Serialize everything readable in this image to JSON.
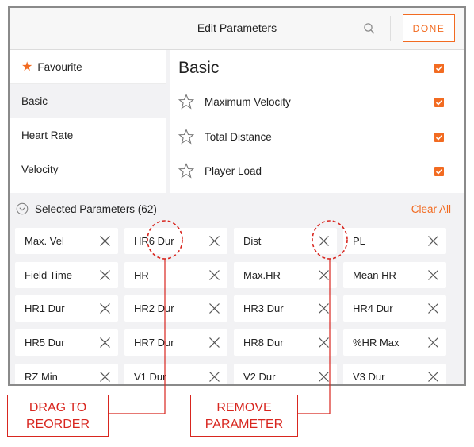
{
  "header": {
    "title": "Edit Parameters",
    "done_label": "DONE"
  },
  "categories": [
    {
      "label": "Favourite",
      "icon": "star-filled-icon"
    },
    {
      "label": "Basic"
    },
    {
      "label": "Heart Rate"
    },
    {
      "label": "Velocity"
    }
  ],
  "basic": {
    "title": "Basic",
    "params": [
      "Maximum Velocity",
      "Total Distance",
      "Player Load"
    ]
  },
  "selected": {
    "label": "Selected Parameters (62)",
    "clear_label": "Clear All",
    "chips": [
      "Max. Vel",
      "HR6 Dur",
      "Dist",
      "PL",
      "Field Time",
      "HR",
      "Max.HR",
      "Mean HR",
      "HR1 Dur",
      "HR2 Dur",
      "HR3 Dur",
      "HR4 Dur",
      "HR5 Dur",
      "HR7 Dur",
      "HR8 Dur",
      "%HR Max",
      "RZ Min",
      "V1 Dur",
      "V2 Dur",
      "V3 Dur"
    ]
  },
  "annotations": {
    "drag_line1": "DRAG TO",
    "drag_line2": "REORDER",
    "remove_line1": "REMOVE",
    "remove_line2": "PARAMETER"
  },
  "colors": {
    "accent": "#f26b21",
    "annotation_red": "#d8261f"
  }
}
